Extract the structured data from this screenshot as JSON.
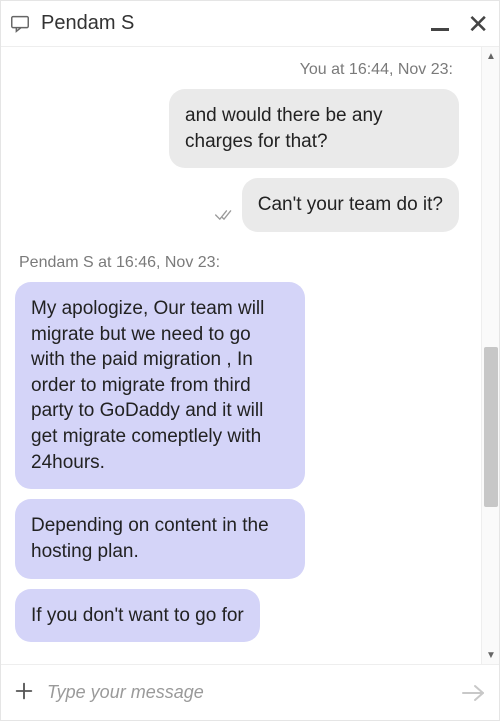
{
  "header": {
    "title": "Pendam S"
  },
  "timestamps": {
    "out": "You at 16:44, Nov 23:",
    "in": "Pendam S at 16:46, Nov 23:"
  },
  "messages": {
    "out1": "and would there be any charges for that?",
    "out2": "Can't your team do it?",
    "in1": "My apologize, Our team will migrate but we need to go with the paid migration , In order to migrate from third party to GoDaddy and it will get migrate comeptlely with 24hours.",
    "in2": "Depending on content in the hosting plan.",
    "in3": "If you don't want to go for"
  },
  "composer": {
    "placeholder": "Type your message",
    "value": ""
  }
}
